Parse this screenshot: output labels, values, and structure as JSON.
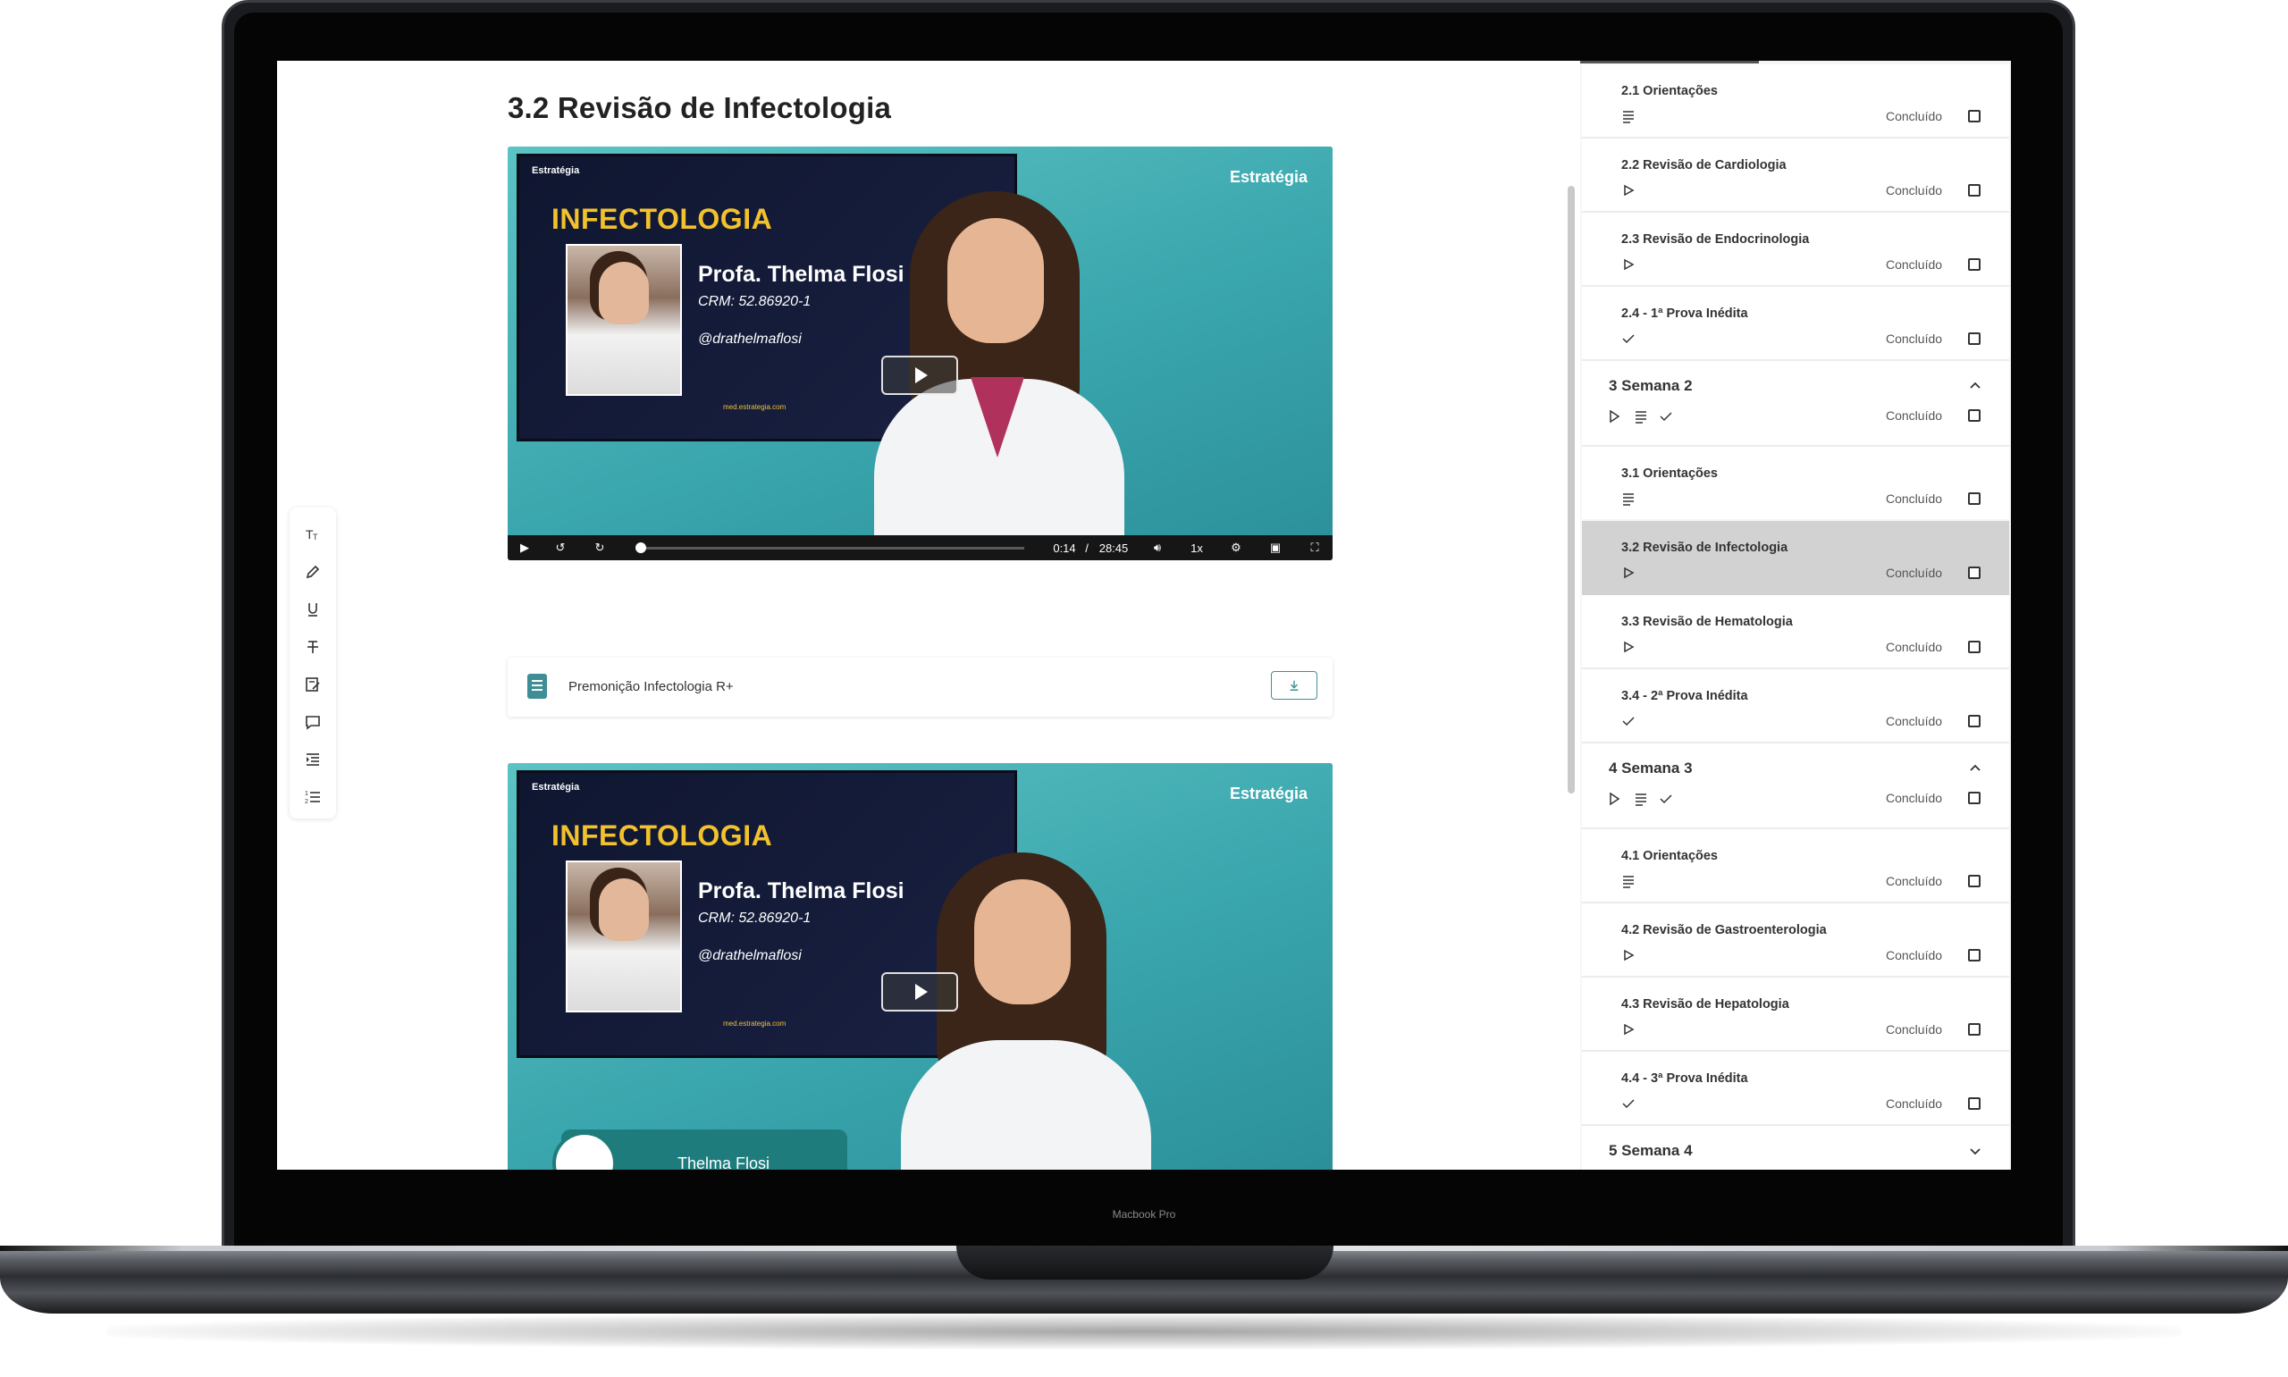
{
  "device": {
    "brand_label": "Macbook Pro"
  },
  "lesson": {
    "title": "3.2 Revisão de Infectologia"
  },
  "toolbar": {
    "tools": [
      "text-size-icon",
      "pen-icon",
      "underline-icon",
      "strikethrough-icon",
      "edit-note-icon",
      "comment-icon",
      "indent-icon",
      "numbered-list-icon"
    ]
  },
  "video1": {
    "card_logo": "Estratégia",
    "subject": "INFECTOLOGIA",
    "teacher": "Profa. Thelma Flosi",
    "crm": "CRM: 52.86920-1",
    "handle": "@drathelmaflosi",
    "site": "med.estrategia.com",
    "brand": "Estratégia",
    "time_current": "0:14",
    "time_separator": "/",
    "time_total": "28:45",
    "speed": "1x",
    "progress": 0.008
  },
  "attachment": {
    "label": "Premonição Infectologia R+"
  },
  "video2": {
    "card_logo": "Estratégia",
    "subject": "INFECTOLOGIA",
    "teacher": "Profa. Thelma Flosi",
    "crm": "CRM: 52.86920-1",
    "handle": "@drathelmaflosi",
    "site": "med.estrategia.com",
    "brand": "Estratégia",
    "ribbon_name": "Thelma Flosi"
  },
  "sidebar": {
    "status_label": "Concluído",
    "items_top": [
      {
        "title": "2.1 Orientações",
        "icon": "text-icon"
      },
      {
        "title": "2.2 Revisão de Cardiologia",
        "icon": "play-icon"
      },
      {
        "title": "2.3 Revisão de Endocrinologia",
        "icon": "play-icon"
      },
      {
        "title": "2.4 - 1ª Prova Inédita",
        "icon": "check-icon"
      }
    ],
    "section3": {
      "title": "3 Semana 2"
    },
    "items_s3": [
      {
        "title": "3.1 Orientações",
        "icon": "text-icon"
      },
      {
        "title": "3.2 Revisão de Infectologia",
        "icon": "play-icon",
        "active": true
      },
      {
        "title": "3.3 Revisão de Hematologia",
        "icon": "play-icon"
      },
      {
        "title": "3.4 - 2ª Prova Inédita",
        "icon": "check-icon"
      }
    ],
    "section4": {
      "title": "4 Semana 3"
    },
    "items_s4": [
      {
        "title": "4.1 Orientações",
        "icon": "text-icon"
      },
      {
        "title": "4.2 Revisão de Gastroenterologia",
        "icon": "play-icon"
      },
      {
        "title": "4.3 Revisão de Hepatologia",
        "icon": "play-icon"
      },
      {
        "title": "4.4 - 3ª Prova Inédita",
        "icon": "check-icon"
      }
    ],
    "section5": {
      "title": "5 Semana 4"
    }
  }
}
